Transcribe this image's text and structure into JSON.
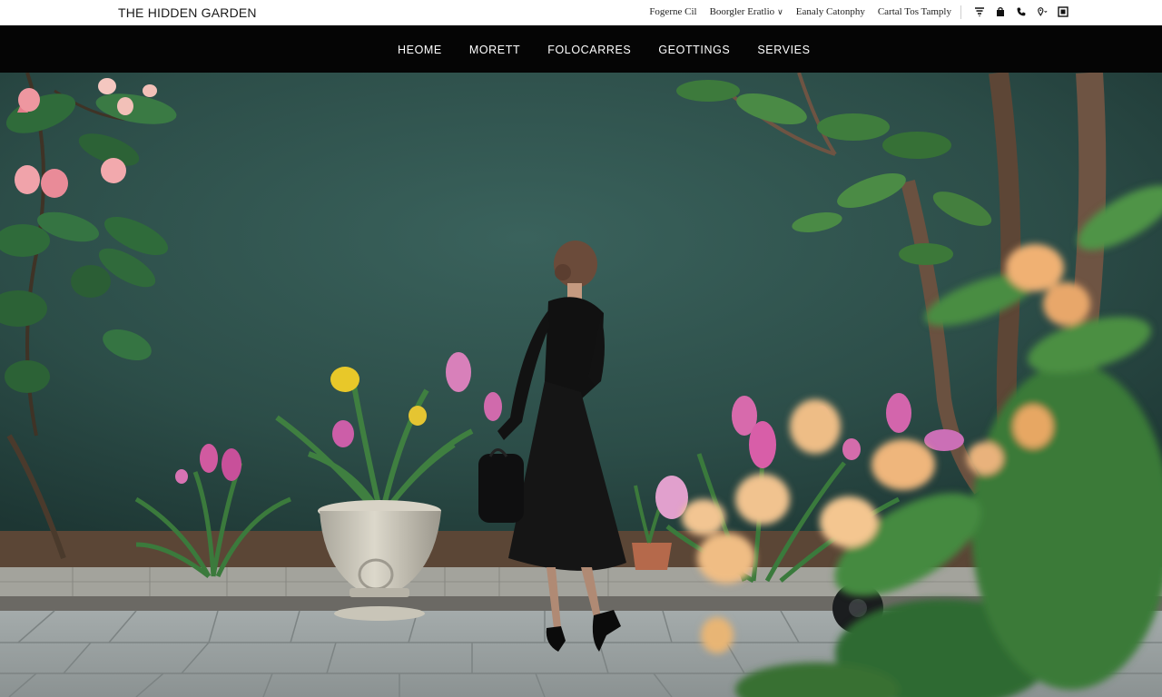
{
  "brand": {
    "name": "THE HIDDEN GARDEN"
  },
  "utility": {
    "links": [
      "Fogerne Cil",
      "Boorgler Eratlio",
      "Eanaly Catonphy",
      "Cartal Tos Tamply"
    ],
    "icons": [
      "filter-icon",
      "bag-icon",
      "phone-icon",
      "location-icon",
      "grid-icon"
    ]
  },
  "nav": {
    "items": [
      "HEOME",
      "MORETT",
      "FOLOCARRES",
      "GEOTTINGS",
      "SERVIES"
    ]
  },
  "hero": {
    "image": "woman-in-black-dress-garden-photo"
  },
  "colors": {
    "nav_bg": "#050505",
    "wall": "#2d4f4a",
    "paving": "#9ca3a3"
  }
}
